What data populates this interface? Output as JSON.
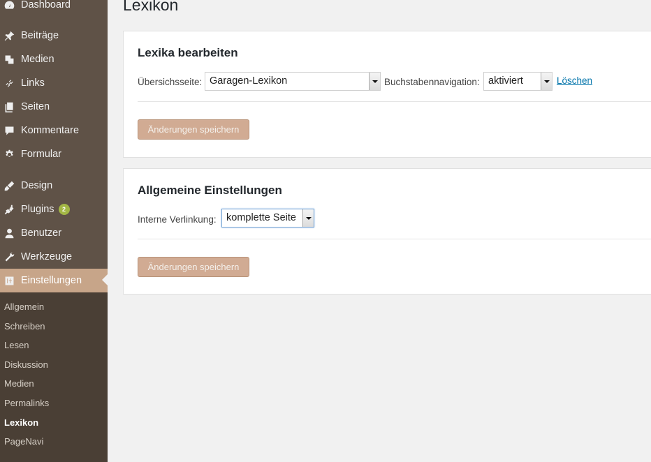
{
  "sidebar": {
    "items": [
      {
        "label": "Dashboard",
        "icon": "dashboard-icon"
      },
      {
        "label": "Beiträge",
        "icon": "pin-icon"
      },
      {
        "label": "Medien",
        "icon": "media-icon"
      },
      {
        "label": "Links",
        "icon": "link-icon"
      },
      {
        "label": "Seiten",
        "icon": "pages-icon"
      },
      {
        "label": "Kommentare",
        "icon": "comment-icon"
      },
      {
        "label": "Formular",
        "icon": "gear-icon"
      },
      {
        "label": "Design",
        "icon": "brush-icon"
      },
      {
        "label": "Plugins",
        "icon": "plugin-icon",
        "badge": "2"
      },
      {
        "label": "Benutzer",
        "icon": "user-icon"
      },
      {
        "label": "Werkzeuge",
        "icon": "wrench-icon"
      },
      {
        "label": "Einstellungen",
        "icon": "settings-icon",
        "active": true
      }
    ],
    "submenu": [
      {
        "label": "Allgemein"
      },
      {
        "label": "Schreiben"
      },
      {
        "label": "Lesen"
      },
      {
        "label": "Diskussion"
      },
      {
        "label": "Medien"
      },
      {
        "label": "Permalinks"
      },
      {
        "label": "Lexikon",
        "current": true
      },
      {
        "label": "PageNavi"
      }
    ],
    "accent_color": "#c7a589"
  },
  "page": {
    "title": "Lexikon"
  },
  "lexika": {
    "heading": "Lexika bearbeiten",
    "overview_label": "Übersichsseite:",
    "overview_value": "Garagen-Lexikon",
    "letter_nav_label": "Buchstabennavigation:",
    "letter_nav_value": "aktiviert",
    "delete_link": "Löschen",
    "save_button": "Änderungen speichern"
  },
  "general": {
    "heading": "Allgemeine Einstellungen",
    "internal_link_label": "Interne Verlinkung:",
    "internal_link_value": "komplette Seite",
    "save_button": "Änderungen speichern"
  }
}
